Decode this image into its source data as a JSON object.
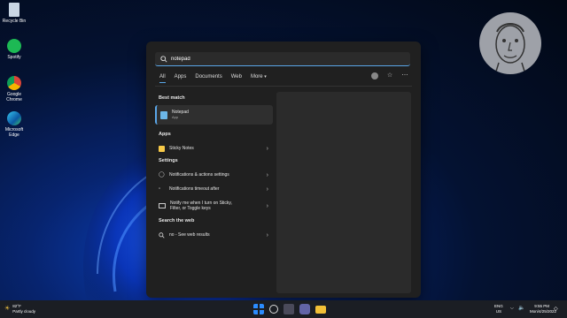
{
  "desktop": {
    "icons": [
      {
        "label": "Recycle Bin",
        "icon": "recycle-bin-icon"
      },
      {
        "label": "Spotify",
        "icon": "spotify-icon"
      },
      {
        "label": "Google Chrome",
        "icon": "chrome-icon"
      },
      {
        "label": "Microsoft Edge",
        "icon": "edge-icon"
      }
    ]
  },
  "search": {
    "query": "notepad",
    "tabs": [
      "All",
      "Apps",
      "Documents",
      "Web",
      "More"
    ],
    "best_match_header": "Best match",
    "best_match": {
      "title": "Notepad",
      "subtitle": "App"
    },
    "apps_header": "Apps",
    "apps": [
      {
        "label": "Sticky Notes"
      }
    ],
    "settings_header": "Settings",
    "settings": [
      {
        "label": "Notifications & actions settings"
      },
      {
        "label": "Notifications timeout after"
      },
      {
        "line1": "Notify me when I turn on Sticky,",
        "line2": "Filter, or Toggle keys"
      }
    ],
    "web_header": "Search the web",
    "web": {
      "label": "no - See web results"
    }
  },
  "taskbar": {
    "weather": {
      "temp": "82°F",
      "condition": "Partly cloudy"
    },
    "tray": {
      "lang": "ENG",
      "region": "US"
    },
    "clock": {
      "time": "9:55 PM",
      "date": "Mon/4/25/2022"
    }
  },
  "colors": {
    "accent": "#5aa6e8",
    "panel": "#202020",
    "preview": "#2b2b2b"
  }
}
